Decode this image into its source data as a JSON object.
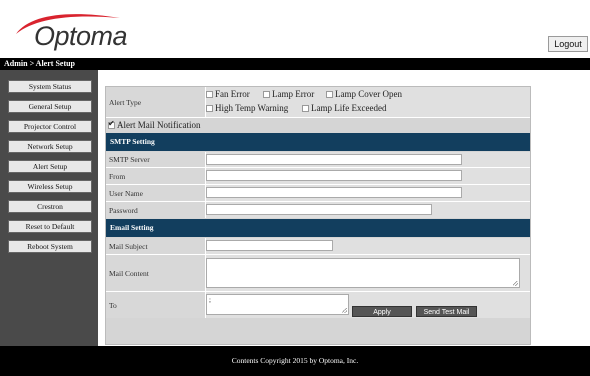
{
  "header": {
    "logo_text": "Optoma",
    "logo_color": "#d9232e",
    "logout_label": "Logout"
  },
  "breadcrumb": "Admin > Alert Setup",
  "sidebar": {
    "items": [
      {
        "label": "System Status"
      },
      {
        "label": "General Setup"
      },
      {
        "label": "Projector Control"
      },
      {
        "label": "Network Setup"
      },
      {
        "label": "Alert Setup",
        "active": true
      },
      {
        "label": "Wireless Setup"
      },
      {
        "label": "Crestron"
      },
      {
        "label": "Reset to Default"
      },
      {
        "label": "Reboot System"
      }
    ]
  },
  "alert": {
    "type_label": "Alert Type",
    "options": [
      {
        "label": "Fan Error",
        "checked": false
      },
      {
        "label": "Lamp Error",
        "checked": false
      },
      {
        "label": "Lamp Cover Open",
        "checked": false
      },
      {
        "label": "High Temp Warning",
        "checked": false
      },
      {
        "label": "Lamp Life Exceeded",
        "checked": false
      }
    ],
    "mail_notification_label": "Alert Mail Notification",
    "mail_notification_checked": true
  },
  "smtp": {
    "section_title": "SMTP Setting",
    "server_label": "SMTP Server",
    "server_value": "",
    "from_label": "From",
    "from_value": "",
    "username_label": "User Name",
    "username_value": "",
    "password_label": "Password",
    "password_value": ""
  },
  "email": {
    "section_title": "Email Setting",
    "subject_label": "Mail Subject",
    "subject_value": "",
    "content_label": "Mail Content",
    "content_value": "",
    "to_label": "To",
    "to_value": ";",
    "apply_label": "Apply",
    "send_test_label": "Send Test Mail"
  },
  "footer": {
    "copyright": "Contents Copyright 2015 by Optoma, Inc."
  },
  "colors": {
    "section_header": "#123e5e",
    "sidebar_bg": "#4a4a4a",
    "panel_bg": "#d5d5d5"
  }
}
